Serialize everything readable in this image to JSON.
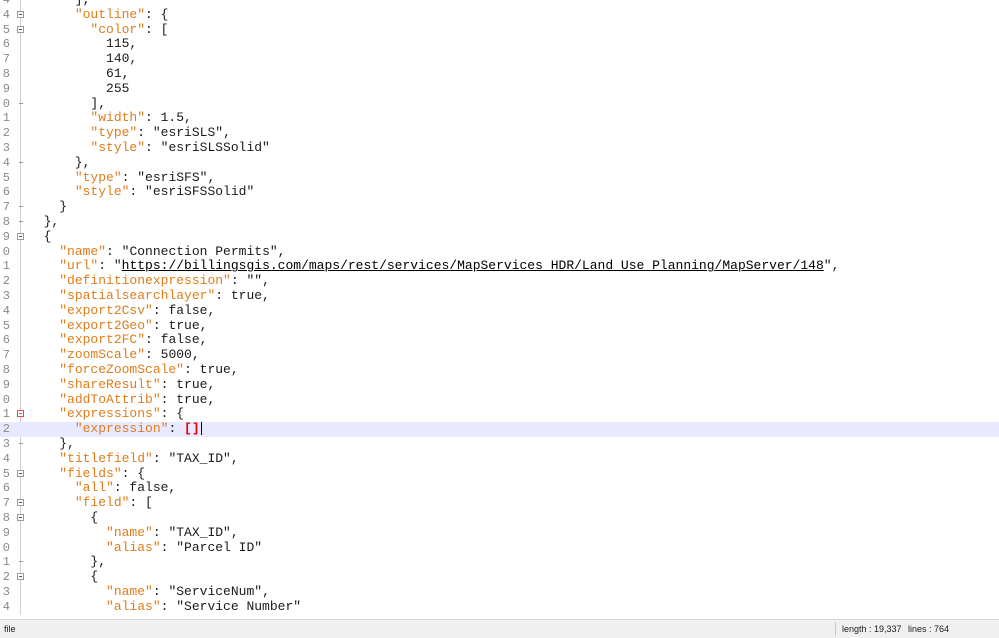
{
  "editor": {
    "lines": [
      {
        "n": "4",
        "fold": "tick",
        "t": [
          [
            "p",
            "      ],"
          ]
        ]
      },
      {
        "n": "4",
        "fold": "box",
        "t": [
          [
            "p",
            "      "
          ],
          [
            "k",
            "\"outline\""
          ],
          [
            "p",
            ": {"
          ]
        ]
      },
      {
        "n": "5",
        "fold": "box",
        "t": [
          [
            "p",
            "        "
          ],
          [
            "k",
            "\"color\""
          ],
          [
            "p",
            ": ["
          ]
        ]
      },
      {
        "n": "6",
        "t": [
          [
            "p",
            "          115,"
          ]
        ]
      },
      {
        "n": "7",
        "t": [
          [
            "p",
            "          140,"
          ]
        ]
      },
      {
        "n": "8",
        "t": [
          [
            "p",
            "          61,"
          ]
        ]
      },
      {
        "n": "9",
        "t": [
          [
            "p",
            "          255"
          ]
        ]
      },
      {
        "n": "0",
        "fold": "tick",
        "t": [
          [
            "p",
            "        ],"
          ]
        ]
      },
      {
        "n": "1",
        "t": [
          [
            "p",
            "        "
          ],
          [
            "k",
            "\"width\""
          ],
          [
            "p",
            ": 1.5,"
          ]
        ]
      },
      {
        "n": "2",
        "t": [
          [
            "p",
            "        "
          ],
          [
            "k",
            "\"type\""
          ],
          [
            "p",
            ": "
          ],
          [
            "s",
            "\"esriSLS\""
          ],
          [
            "p",
            ","
          ]
        ]
      },
      {
        "n": "3",
        "t": [
          [
            "p",
            "        "
          ],
          [
            "k",
            "\"style\""
          ],
          [
            "p",
            ": "
          ],
          [
            "s",
            "\"esriSLSSolid\""
          ]
        ]
      },
      {
        "n": "4",
        "fold": "tick",
        "t": [
          [
            "p",
            "      },"
          ]
        ]
      },
      {
        "n": "5",
        "t": [
          [
            "p",
            "      "
          ],
          [
            "k",
            "\"type\""
          ],
          [
            "p",
            ": "
          ],
          [
            "s",
            "\"esriSFS\""
          ],
          [
            "p",
            ","
          ]
        ]
      },
      {
        "n": "6",
        "t": [
          [
            "p",
            "      "
          ],
          [
            "k",
            "\"style\""
          ],
          [
            "p",
            ": "
          ],
          [
            "s",
            "\"esriSFSSolid\""
          ]
        ]
      },
      {
        "n": "7",
        "fold": "tick",
        "t": [
          [
            "p",
            "    }"
          ]
        ]
      },
      {
        "n": "8",
        "fold": "tick",
        "t": [
          [
            "p",
            "  },"
          ]
        ]
      },
      {
        "n": "9",
        "fold": "box",
        "t": [
          [
            "p",
            "  {"
          ]
        ]
      },
      {
        "n": "0",
        "t": [
          [
            "p",
            "    "
          ],
          [
            "k",
            "\"name\""
          ],
          [
            "p",
            ": "
          ],
          [
            "s",
            "\"Connection Permits\""
          ],
          [
            "p",
            ","
          ]
        ]
      },
      {
        "n": "1",
        "t": [
          [
            "p",
            "    "
          ],
          [
            "k",
            "\"url\""
          ],
          [
            "p",
            ": \""
          ],
          [
            "u",
            "https://billingsgis.com/maps/rest/services/MapServices_HDR/Land_Use_Planning/MapServer/148"
          ],
          [
            "p",
            "\","
          ]
        ]
      },
      {
        "n": "2",
        "t": [
          [
            "p",
            "    "
          ],
          [
            "k",
            "\"definitionexpression\""
          ],
          [
            "p",
            ": \"\","
          ]
        ]
      },
      {
        "n": "3",
        "t": [
          [
            "p",
            "    "
          ],
          [
            "k",
            "\"spatialsearchlayer\""
          ],
          [
            "p",
            ": true,"
          ]
        ]
      },
      {
        "n": "4",
        "t": [
          [
            "p",
            "    "
          ],
          [
            "k",
            "\"export2Csv\""
          ],
          [
            "p",
            ": false,"
          ]
        ]
      },
      {
        "n": "5",
        "t": [
          [
            "p",
            "    "
          ],
          [
            "k",
            "\"export2Geo\""
          ],
          [
            "p",
            ": true,"
          ]
        ]
      },
      {
        "n": "6",
        "t": [
          [
            "p",
            "    "
          ],
          [
            "k",
            "\"export2FC\""
          ],
          [
            "p",
            ": false,"
          ]
        ]
      },
      {
        "n": "7",
        "t": [
          [
            "p",
            "    "
          ],
          [
            "k",
            "\"zoomScale\""
          ],
          [
            "p",
            ": 5000,"
          ]
        ]
      },
      {
        "n": "8",
        "t": [
          [
            "p",
            "    "
          ],
          [
            "k",
            "\"forceZoomScale\""
          ],
          [
            "p",
            ": true,"
          ]
        ]
      },
      {
        "n": "9",
        "t": [
          [
            "p",
            "    "
          ],
          [
            "k",
            "\"shareResult\""
          ],
          [
            "p",
            ": true,"
          ]
        ]
      },
      {
        "n": "0",
        "t": [
          [
            "p",
            "    "
          ],
          [
            "k",
            "\"addToAttrib\""
          ],
          [
            "p",
            ": true,"
          ]
        ]
      },
      {
        "n": "1",
        "fold": "red",
        "t": [
          [
            "p",
            "    "
          ],
          [
            "k",
            "\"expressions\""
          ],
          [
            "p",
            ": {"
          ]
        ]
      },
      {
        "n": "2",
        "current": true,
        "t": [
          [
            "p",
            "      "
          ],
          [
            "k",
            "\"expression\""
          ],
          [
            "p",
            ": "
          ],
          [
            "br",
            "[]"
          ]
        ]
      },
      {
        "n": "3",
        "fold": "tick",
        "t": [
          [
            "p",
            "    },"
          ]
        ]
      },
      {
        "n": "4",
        "t": [
          [
            "p",
            "    "
          ],
          [
            "k",
            "\"titlefield\""
          ],
          [
            "p",
            ": "
          ],
          [
            "s",
            "\"TAX_ID\""
          ],
          [
            "p",
            ","
          ]
        ]
      },
      {
        "n": "5",
        "fold": "box",
        "t": [
          [
            "p",
            "    "
          ],
          [
            "k",
            "\"fields\""
          ],
          [
            "p",
            ": {"
          ]
        ]
      },
      {
        "n": "6",
        "t": [
          [
            "p",
            "      "
          ],
          [
            "k",
            "\"all\""
          ],
          [
            "p",
            ": false,"
          ]
        ]
      },
      {
        "n": "7",
        "fold": "box",
        "t": [
          [
            "p",
            "      "
          ],
          [
            "k",
            "\"field\""
          ],
          [
            "p",
            ": ["
          ]
        ]
      },
      {
        "n": "8",
        "fold": "box",
        "t": [
          [
            "p",
            "        {"
          ]
        ]
      },
      {
        "n": "9",
        "t": [
          [
            "p",
            "          "
          ],
          [
            "k",
            "\"name\""
          ],
          [
            "p",
            ": "
          ],
          [
            "s",
            "\"TAX_ID\""
          ],
          [
            "p",
            ","
          ]
        ]
      },
      {
        "n": "0",
        "t": [
          [
            "p",
            "          "
          ],
          [
            "k",
            "\"alias\""
          ],
          [
            "p",
            ": "
          ],
          [
            "s",
            "\"Parcel ID\""
          ]
        ]
      },
      {
        "n": "1",
        "fold": "tick",
        "t": [
          [
            "p",
            "        },"
          ]
        ]
      },
      {
        "n": "2",
        "fold": "box",
        "t": [
          [
            "p",
            "        {"
          ]
        ]
      },
      {
        "n": "3",
        "t": [
          [
            "p",
            "          "
          ],
          [
            "k",
            "\"name\""
          ],
          [
            "p",
            ": "
          ],
          [
            "s",
            "\"ServiceNum\""
          ],
          [
            "p",
            ","
          ]
        ]
      },
      {
        "n": "4",
        "t": [
          [
            "p",
            "          "
          ],
          [
            "k",
            "\"alias\""
          ],
          [
            "p",
            ": "
          ],
          [
            "s",
            "\"Service Number\""
          ]
        ]
      }
    ]
  },
  "status_bar": {
    "file_type": "file",
    "length": "length : 19,337",
    "lines": "lines : 764"
  }
}
